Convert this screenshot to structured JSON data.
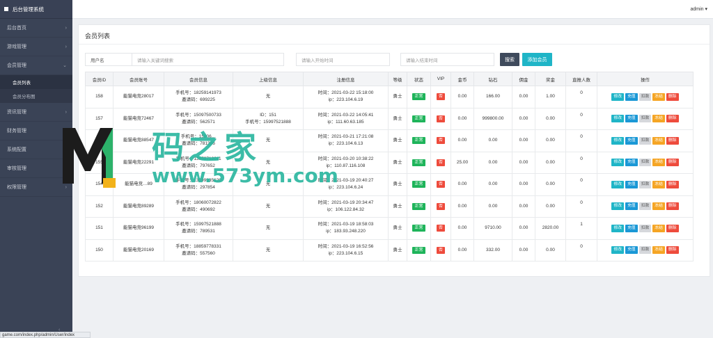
{
  "app": {
    "title": "后台管理系统"
  },
  "topbar": {
    "user": "admin"
  },
  "sidebar": {
    "items": [
      {
        "label": "后台首页",
        "chevron": "›"
      },
      {
        "label": "游戏管理",
        "chevron": "›"
      },
      {
        "label": "会员管理",
        "chevron": "⌄"
      },
      {
        "label": "资讯管理",
        "chevron": "›"
      },
      {
        "label": "财务管理",
        "chevron": "›"
      },
      {
        "label": "系统配置",
        "chevron": "›"
      },
      {
        "label": "审核管理",
        "chevron": "›"
      },
      {
        "label": "权限管理",
        "chevron": "›"
      }
    ],
    "subitems": [
      {
        "label": "会员列表"
      },
      {
        "label": "会员分布图"
      }
    ],
    "collapse": "‹"
  },
  "panel": {
    "title": "会员列表"
  },
  "search": {
    "label": "用户名",
    "keyword_placeholder": "请输入关键词搜索",
    "start_placeholder": "请输入开始时间",
    "end_placeholder": "请输入结束时间",
    "search_label": "搜索",
    "add_label": "添加会员"
  },
  "table": {
    "headers": [
      "会员ID",
      "会员账号",
      "会员信息",
      "上级信息",
      "注册信息",
      "等级",
      "状态",
      "VIP",
      "金币",
      "钻石",
      "佣金",
      "奖金",
      "直推人数",
      "操作"
    ],
    "ops": {
      "edit": "修改",
      "recharge": "充值",
      "deduct": "扣款",
      "freeze": "冻结",
      "delete": "删除"
    },
    "rows": [
      {
        "id": "158",
        "account": "能猫电竞28017",
        "phone": "手机号：18259141973",
        "invite": "邀请码：699225",
        "parent1": "无",
        "parent2": "",
        "time": "时间：2021-03-22 15:18:00",
        "ip": "ip：223.104.6.19",
        "level": "勇士",
        "status": "正常",
        "vip": "否",
        "gold": "0.00",
        "diamond": "166.00",
        "commission": "0.00",
        "bonus": "1.00",
        "referrals": "0"
      },
      {
        "id": "157",
        "account": "能猫电竞72467",
        "phone": "手机号：15097500733",
        "invite": "邀请码：562571",
        "parent1": "ID：151",
        "parent2": "手机号：15997521888",
        "time": "时间：2021-03-22 14:05:41",
        "ip": "ip：111.60.63.185",
        "level": "勇士",
        "status": "正常",
        "vip": "否",
        "gold": "0.00",
        "diamond": "999800.00",
        "commission": "0.00",
        "bonus": "0.00",
        "referrals": "0"
      },
      {
        "id": "156",
        "account": "能猫电竞88547",
        "phone": "手机号：15906…",
        "invite": "邀请码：781386",
        "parent1": "无",
        "parent2": "",
        "time": "时间：2021-03-21 17:21:08",
        "ip": "ip：223.104.6.13",
        "level": "勇士",
        "status": "正常",
        "vip": "否",
        "gold": "0.00",
        "diamond": "0.00",
        "commission": "0.00",
        "bonus": "0.00",
        "referrals": "0"
      },
      {
        "id": "155",
        "account": "能猫电竞22291",
        "phone": "手机号：13859712011",
        "invite": "邀请码：797652",
        "parent1": "无",
        "parent2": "",
        "time": "时间：2021-03-20 10:38:22",
        "ip": "ip：110.87.116.108",
        "level": "勇士",
        "status": "正常",
        "vip": "否",
        "gold": "25.00",
        "diamond": "0.00",
        "commission": "0.00",
        "bonus": "0.00",
        "referrals": "0"
      },
      {
        "id": "154",
        "account": "能猫电竞…89",
        "phone": "手机号：13599935620",
        "invite": "邀请码：297854",
        "parent1": "无",
        "parent2": "",
        "time": "时间：2021-03-19 20:40:27",
        "ip": "ip：223.104.6.24",
        "level": "勇士",
        "status": "正常",
        "vip": "否",
        "gold": "0.00",
        "diamond": "0.00",
        "commission": "0.00",
        "bonus": "0.00",
        "referrals": "0"
      },
      {
        "id": "152",
        "account": "能猫电竞89289",
        "phone": "手机号：18060072822",
        "invite": "邀请码：490692",
        "parent1": "无",
        "parent2": "",
        "time": "时间：2021-03-19 20:34:47",
        "ip": "ip：106.122.84.32",
        "level": "勇士",
        "status": "正常",
        "vip": "否",
        "gold": "0.00",
        "diamond": "0.00",
        "commission": "0.00",
        "bonus": "0.00",
        "referrals": "0"
      },
      {
        "id": "151",
        "account": "能猫电竞96199",
        "phone": "手机号：15997521888",
        "invite": "邀请码：789531",
        "parent1": "无",
        "parent2": "",
        "time": "时间：2021-03-19 18:58:03",
        "ip": "ip：183.93.248.220",
        "level": "勇士",
        "status": "正常",
        "vip": "否",
        "gold": "0.00",
        "diamond": "9710.00",
        "commission": "0.00",
        "bonus": "2820.00",
        "referrals": "1"
      },
      {
        "id": "150",
        "account": "能猫电竞20169",
        "phone": "手机号：18859778331",
        "invite": "邀请码：557560",
        "parent1": "无",
        "parent2": "",
        "time": "时间：2021-03-19 16:52:56",
        "ip": "ip：223.104.6.15",
        "level": "勇士",
        "status": "正常",
        "vip": "否",
        "gold": "0.00",
        "diamond": "332.00",
        "commission": "0.00",
        "bonus": "0.00",
        "referrals": "0"
      }
    ]
  },
  "statusbar": {
    "url": "game.com/index.php/admin/User/index"
  },
  "watermark": {
    "cn": "码之家",
    "en": "www.573ym.com"
  },
  "colors": {
    "sidebar": "#3a4356",
    "accent": "#1fb5c7",
    "success": "#1eb45a",
    "danger": "#ee4b3c",
    "warning": "#f5a524",
    "recharge": "#1a98d6",
    "watermark": "#2cb7a0"
  }
}
